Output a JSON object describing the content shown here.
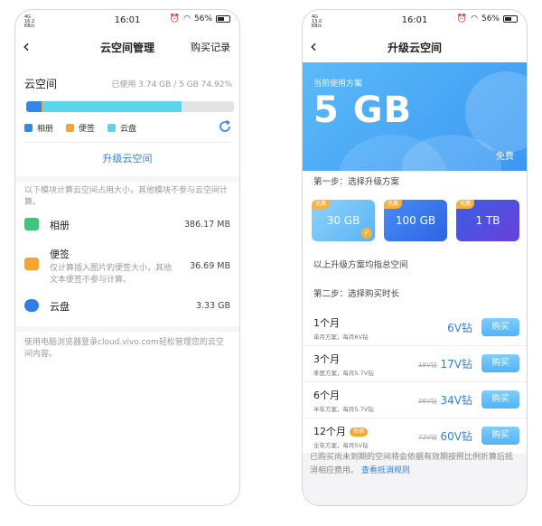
{
  "left": {
    "status": {
      "network": "4G",
      "speed": "16.2",
      "speed_unit": "KB/s",
      "time": "16:01",
      "battery": "56%"
    },
    "nav": {
      "title": "云空间管理",
      "right_link": "购买记录"
    },
    "storage": {
      "name": "云空间",
      "used_text": "已使用 3.74 GB / 5 GB 74.92%",
      "used_percent": 74.92,
      "segments": {
        "albums_percent": 7.3,
        "notes_percent": 0.7,
        "cloud_percent": 66.92
      }
    },
    "legend": [
      {
        "label": "相册",
        "color": "#2f89e8"
      },
      {
        "label": "便签",
        "color": "#f5a331"
      },
      {
        "label": "云盘",
        "color": "#5ad6ec"
      }
    ],
    "upgrade_label": "升级云空间",
    "module_note": "以下模块计算云空间占用大小，其他模块不参与云空间计算。",
    "modules": [
      {
        "name": "相册",
        "size": "386.17 MB",
        "desc": ""
      },
      {
        "name": "便签",
        "size": "36.69 MB",
        "desc": "仅计算插入图片的便签大小，其他文本便签不参与计算。"
      },
      {
        "name": "云盘",
        "size": "3.33 GB",
        "desc": ""
      }
    ],
    "footer_note": "使用电脑浏览器登录cloud.vivo.com轻松管理您的云空间内容。"
  },
  "right": {
    "status": {
      "network": "4G",
      "speed": "13.0",
      "speed_unit": "KB/s",
      "time": "16:01",
      "battery": "56%"
    },
    "nav": {
      "title": "升级云空间"
    },
    "current_plan": {
      "label": "当前使用方案",
      "size": "5 GB",
      "type": "免费"
    },
    "step1": "第一步：选择升级方案",
    "plans": [
      {
        "tag": "优惠",
        "label": "30 GB",
        "selected": true
      },
      {
        "tag": "优惠",
        "label": "100 GB",
        "selected": false
      },
      {
        "tag": "优惠",
        "label": "1 TB",
        "selected": false
      }
    ],
    "plans_note": "以上升级方案均指总空间",
    "step2": "第二步：选择购买时长",
    "durations": [
      {
        "name": "1个月",
        "desc": "单月方案，每月6V钻",
        "old_price": "",
        "price": "6V钻",
        "buy": "购买",
        "hot": ""
      },
      {
        "name": "3个月",
        "desc": "季度方案，每月5.7V钻",
        "old_price": "18V钻",
        "price": "17V钻",
        "buy": "购买",
        "hot": ""
      },
      {
        "name": "6个月",
        "desc": "半年方案，每月5.7V钻",
        "old_price": "36V钻",
        "price": "34V钻",
        "buy": "购买",
        "hot": ""
      },
      {
        "name": "12个月",
        "desc": "全年方案，每月5V钻",
        "old_price": "72V钻",
        "price": "60V钻",
        "buy": "购买",
        "hot": "热销"
      }
    ],
    "bottom_note": "已购买尚未到期的空间将会依据有效期按照比例折算后抵消相应费用。",
    "bottom_link": "查看抵消规则"
  }
}
